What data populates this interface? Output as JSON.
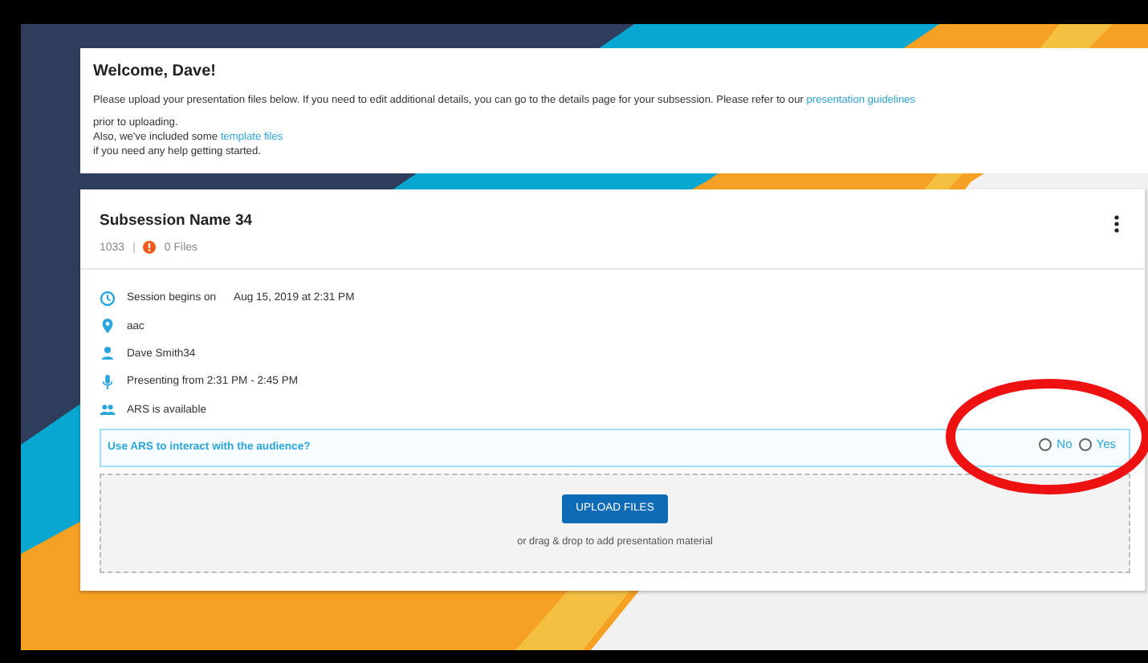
{
  "welcome": {
    "title": "Welcome, Dave!",
    "lines": [
      [
        {
          "kind": "text",
          "text": "Please upload your presentation files below. If you need to edit additional details, you can go to the details page for your subsession. Please refer to our "
        },
        {
          "kind": "link",
          "text": "presentation guidelines"
        }
      ],
      [
        {
          "kind": "text",
          "text": "prior to uploading."
        }
      ],
      [
        {
          "kind": "text",
          "text": "Also, we've included some "
        },
        {
          "kind": "link",
          "text": "template files"
        }
      ],
      [
        {
          "kind": "text",
          "text": "if you need any help getting started."
        }
      ]
    ]
  },
  "session": {
    "title": "Subsession Name 34",
    "id": "1033",
    "separator": "|",
    "files": "0 Files",
    "details": [
      {
        "kind": "time",
        "text": "Session begins on",
        "value": "Aug 15, 2019 at 2:31 PM"
      },
      {
        "kind": "location",
        "text": "aac"
      },
      {
        "kind": "person",
        "text": "Dave Smith34"
      },
      {
        "kind": "microphone",
        "text": "Presenting from 2:31 PM - 2:45 PM"
      },
      {
        "kind": "group",
        "text": "ARS is available"
      }
    ],
    "ars": {
      "question": "Use ARS to interact with the audience?",
      "options": [
        {
          "label": "No",
          "selected": false
        },
        {
          "label": "Yes",
          "selected": false
        }
      ]
    },
    "upload": {
      "button": "UPLOAD FILES",
      "hint": "or drag & drop to add presentation material"
    }
  }
}
